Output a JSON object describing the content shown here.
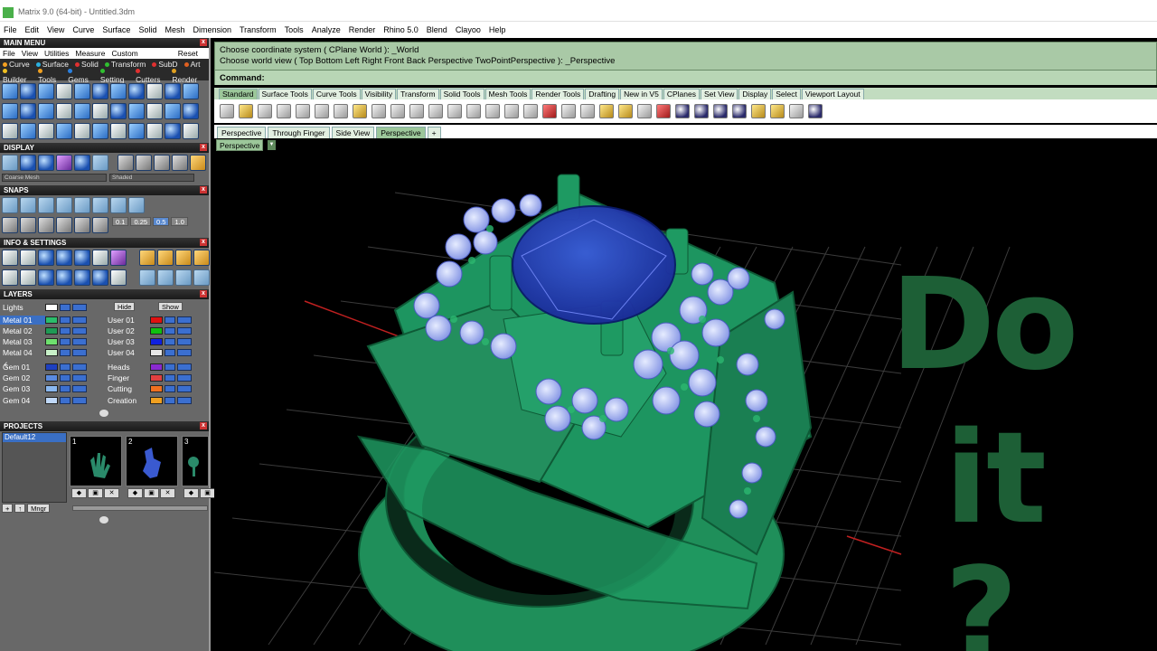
{
  "window": {
    "title": "Matrix 9.0 (64-bit) - Untitled.3dm"
  },
  "menu": [
    "File",
    "Edit",
    "View",
    "Curve",
    "Surface",
    "Solid",
    "Mesh",
    "Dimension",
    "Transform",
    "Tools",
    "Analyze",
    "Render",
    "Rhino 5.0",
    "Blend",
    "Clayoo",
    "Help"
  ],
  "main_menu": {
    "title": "MAIN MENU",
    "row1": [
      "File",
      "View",
      "Utilities",
      "Measure",
      "Custom"
    ],
    "reset": "Reset",
    "row2": [
      "Curve",
      "Surface",
      "Solid",
      "Transform",
      "SubD",
      "Art"
    ],
    "row3": [
      "Builder",
      "Tools",
      "Gems",
      "Setting",
      "Cutters",
      "Render"
    ]
  },
  "display": {
    "title": "DISPLAY",
    "mesh_combo": "Coarse Mesh",
    "shade_combo": "Shaded"
  },
  "snaps": {
    "title": "SNAPS",
    "values": [
      "0.1",
      "0.25",
      "0.5",
      "1.0"
    ]
  },
  "info": {
    "title": "INFO & SETTINGS"
  },
  "layers": {
    "title": "LAYERS",
    "lights": "Lights",
    "hide": "Hide",
    "show": "Show",
    "left": [
      {
        "name": "Metal 01",
        "color": "#2bbd6b",
        "selected": true
      },
      {
        "name": "Metal 02",
        "color": "#1f9a55",
        "selected": false
      },
      {
        "name": "Metal 03",
        "color": "#6ee06e",
        "selected": false
      },
      {
        "name": "Metal 04",
        "color": "#c8f0c8",
        "selected": false
      },
      {
        "name": "Gem 01",
        "color": "#1e40c0",
        "selected": false
      },
      {
        "name": "Gem 02",
        "color": "#5a8ae0",
        "selected": false
      },
      {
        "name": "Gem 03",
        "color": "#8ab8f0",
        "selected": false
      },
      {
        "name": "Gem 04",
        "color": "#c0d8f8",
        "selected": false
      }
    ],
    "right": [
      {
        "name": "User 01",
        "color": "#e01010"
      },
      {
        "name": "User 02",
        "color": "#10c010"
      },
      {
        "name": "User 03",
        "color": "#1020e0"
      },
      {
        "name": "User 04",
        "color": "#e8e8e8"
      },
      {
        "name": "Heads",
        "color": "#8a2ad0"
      },
      {
        "name": "Finger",
        "color": "#e04040"
      },
      {
        "name": "Cutting",
        "color": "#f07020"
      },
      {
        "name": "Creation",
        "color": "#f0a020"
      }
    ]
  },
  "projects": {
    "title": "PROJECTS",
    "items": [
      "Default12"
    ],
    "thumbs": [
      "1",
      "2",
      "3"
    ],
    "mngr": "Mngr"
  },
  "command": {
    "line1": "Choose coordinate system ( CPlane  World ):  _World",
    "line2": "Choose world view ( Top  Bottom  Left  Right  Front  Back  Perspective  TwoPointPerspective ):  _Perspective",
    "prompt": "Command:"
  },
  "toolbar_tabs": [
    "Standard",
    "Surface Tools",
    "Curve Tools",
    "Visibility",
    "Transform",
    "Solid Tools",
    "Mesh Tools",
    "Render Tools",
    "Drafting",
    "New in V5",
    "CPlanes",
    "Set View",
    "Display",
    "Select",
    "Viewport Layout"
  ],
  "viewport_tabs": [
    "Perspective",
    "Through Finger",
    "Side View",
    "Perspective"
  ],
  "viewport_label": "Perspective",
  "overlay": {
    "line1": "Do",
    "line2": "it ?"
  }
}
